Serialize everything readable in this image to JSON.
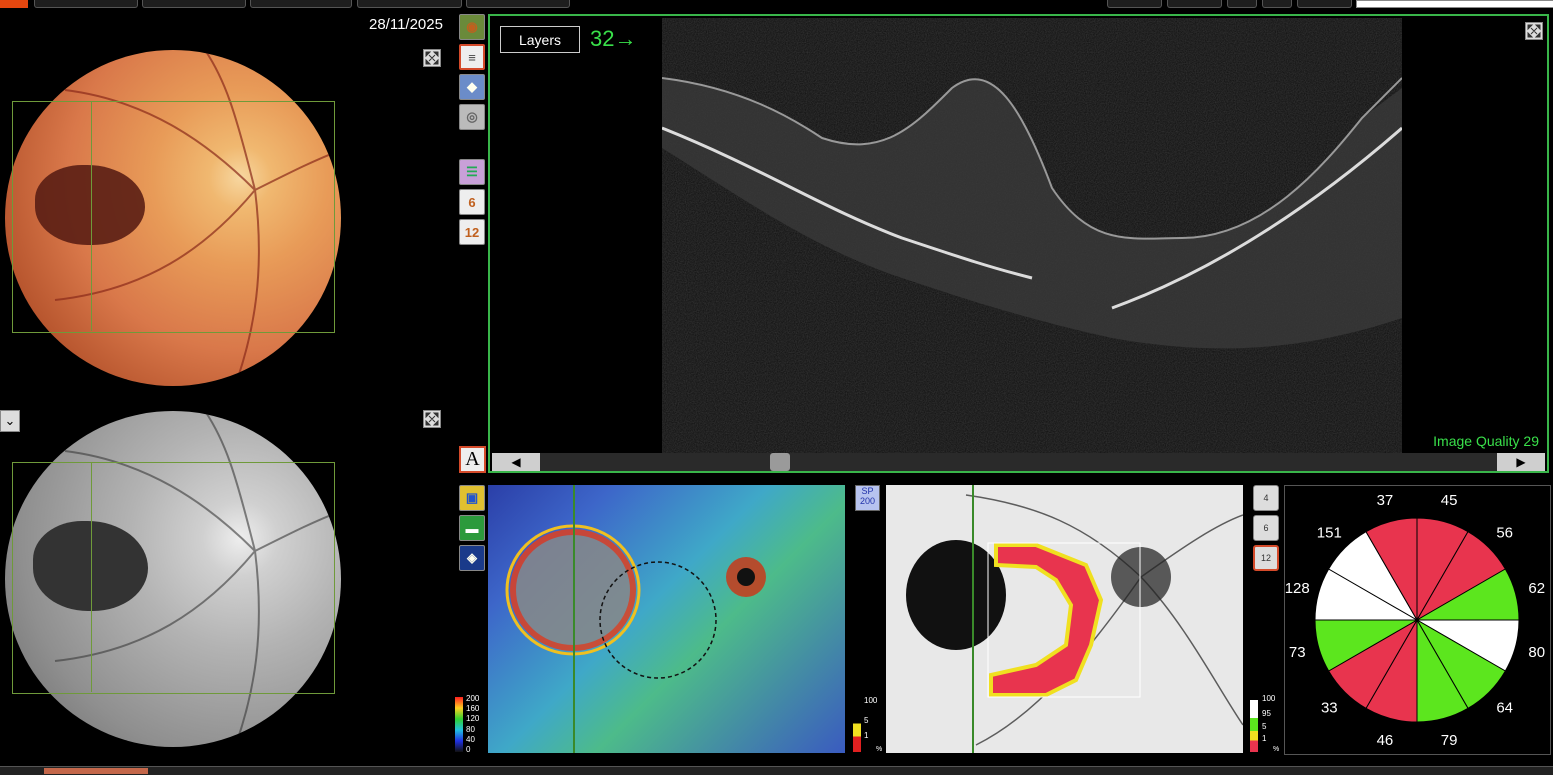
{
  "header": {
    "date": "28/11/2025"
  },
  "oct": {
    "layers_label": "Layers",
    "slice_label": "32→",
    "image_quality": "Image Quality 29",
    "scroll_left": "◀",
    "scroll_right": "▶"
  },
  "toolbar_left": {
    "a_label": "A",
    "grid6_label": "6",
    "grid12_label": "12"
  },
  "sp_button": {
    "line1": "SP",
    "line2": "200"
  },
  "thickness_scale": [
    "200",
    "160",
    "120",
    "80",
    "40",
    "0"
  ],
  "deviation_scale_left": [
    "100",
    "5",
    "1",
    "%"
  ],
  "deviation_scale_right": [
    "100",
    "95",
    "5",
    "1",
    "%"
  ],
  "grid_buttons": [
    "4",
    "6",
    "12"
  ],
  "sectors": [
    {
      "value": "45",
      "status": "red"
    },
    {
      "value": "56",
      "status": "red"
    },
    {
      "value": "62",
      "status": "green"
    },
    {
      "value": "80",
      "status": "white"
    },
    {
      "value": "64",
      "status": "green"
    },
    {
      "value": "79",
      "status": "green"
    },
    {
      "value": "46",
      "status": "red"
    },
    {
      "value": "33",
      "status": "red"
    },
    {
      "value": "73",
      "status": "green"
    },
    {
      "value": "128",
      "status": "white"
    },
    {
      "value": "151",
      "status": "white"
    },
    {
      "value": "37",
      "status": "red"
    }
  ],
  "colors": {
    "accent_green": "#39b54a",
    "sector_red": "#e8344e",
    "sector_green": "#5ce61e",
    "sector_white": "#ffffff"
  }
}
